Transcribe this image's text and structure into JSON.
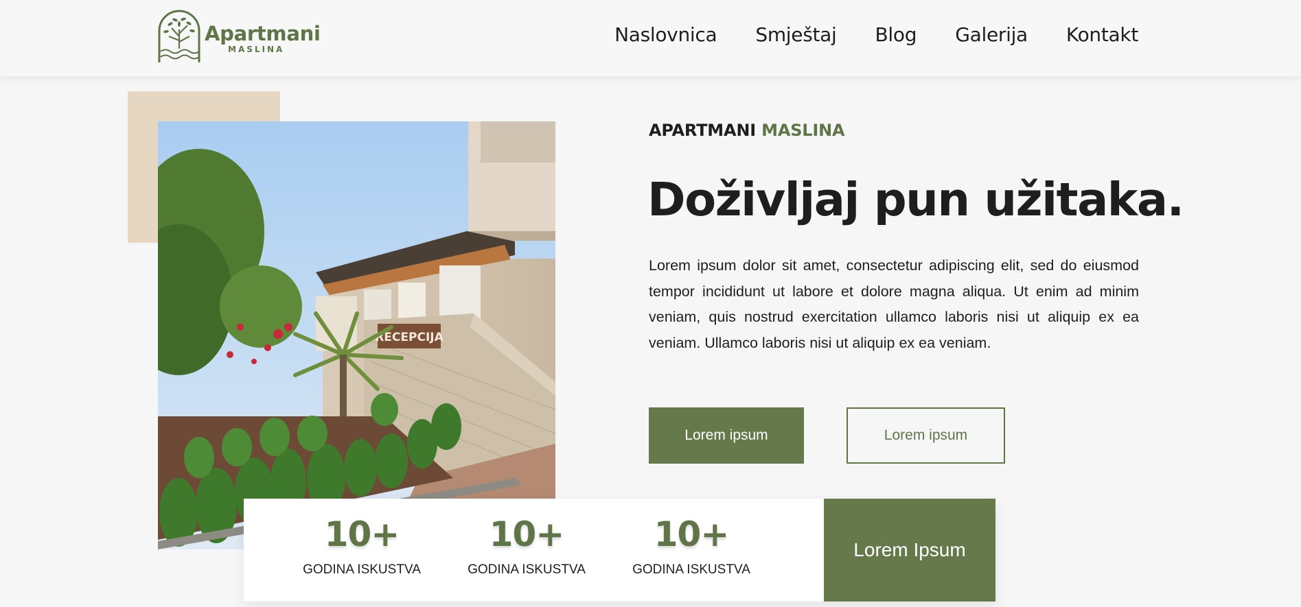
{
  "brand": {
    "name": "Apartmani",
    "subname": "MASLINA",
    "primary_color": "#65794b",
    "accent_color": "#5f7548",
    "beige_color": "#e6d7c2",
    "logo_icon": "olive-tree-arch-icon"
  },
  "nav": {
    "items": [
      "Naslovnica",
      "Smještaj",
      "Blog",
      "Galerija",
      "Kontakt"
    ]
  },
  "hero": {
    "eyebrow_dark": "APARTMANI",
    "eyebrow_accent": "MASLINA",
    "title": "Doživljaj pun užitaka.",
    "body": "Lorem ipsum dolor sit amet, consectetur adipiscing elit, sed do eiusmod tempor incididunt ut labore et dolore magna aliqua. Ut enim ad minim veniam, quis nostrud exercitation ullamco laboris nisi ut aliquip ex ea veniam. Ullamco laboris nisi ut aliquip ex ea veniam.",
    "primary_button": "Lorem ipsum",
    "secondary_button": "Lorem ipsum",
    "photo_sign_text": "RECEPCIJA"
  },
  "stats": {
    "items": [
      {
        "value": "10+",
        "label": "GODINA ISKUSTVA"
      },
      {
        "value": "10+",
        "label": "GODINA ISKUSTVA"
      },
      {
        "value": "10+",
        "label": "GODINA ISKUSTVA"
      }
    ],
    "cta": "Lorem Ipsum"
  }
}
